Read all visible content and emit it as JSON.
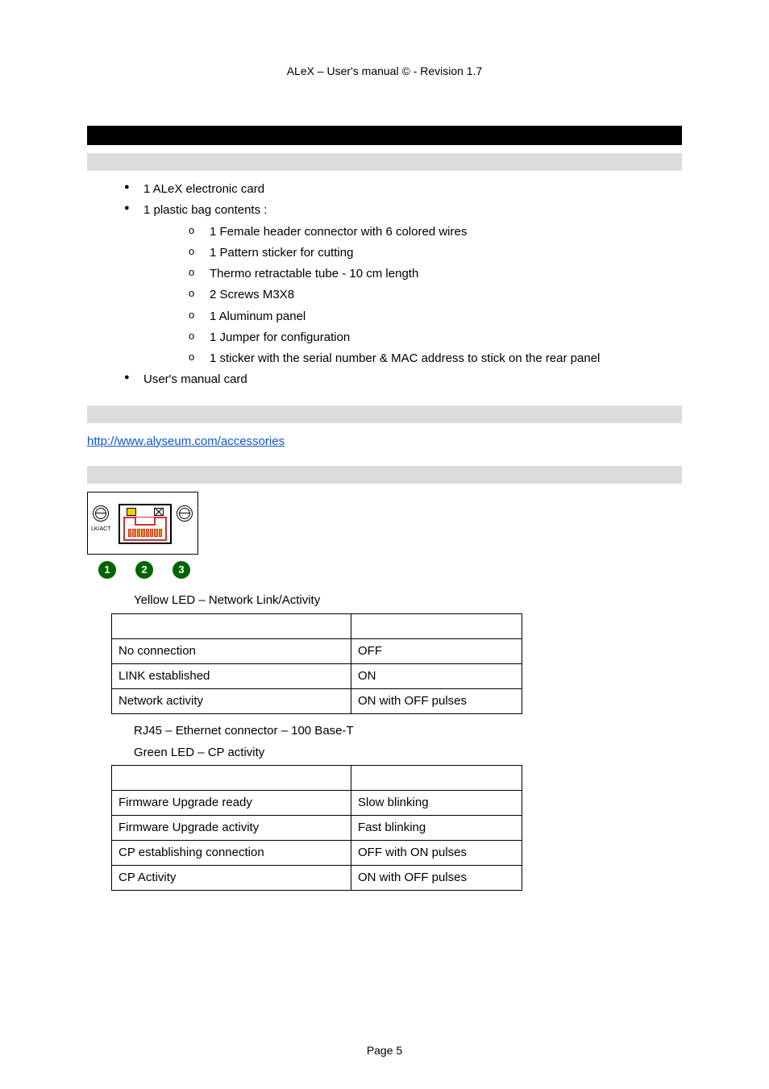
{
  "header": "ALeX – User's manual © -  Revision 1.7",
  "bullets": [
    "1 ALeX electronic card",
    "1 plastic bag contents :"
  ],
  "sub_bullets": [
    "1 Female header connector with 6 colored wires",
    "1 Pattern sticker for cutting",
    "Thermo retractable tube - 10 cm length",
    "2 Screws M3X8",
    "1 Aluminum panel",
    "1 Jumper for configuration",
    "1 sticker with the serial number & MAC address to stick on the rear panel"
  ],
  "bullets2": [
    "User's manual card"
  ],
  "accessories_url": "http://www.alyseum.com/accessories",
  "lkact_label": "LK/ACT",
  "callout_numbers": [
    "1",
    "2",
    "3"
  ],
  "caption1": "Yellow LED  – Network Link/Activity",
  "table1": {
    "rows": [
      [
        "No connection",
        "OFF"
      ],
      [
        "LINK established",
        "ON"
      ],
      [
        "Network activity",
        "ON with OFF pulses"
      ]
    ]
  },
  "caption2a": "RJ45 – Ethernet connector – 100 Base-T",
  "caption2b": "Green LED – CP activity",
  "table2": {
    "rows": [
      [
        "Firmware Upgrade ready",
        "Slow blinking"
      ],
      [
        "Firmware Upgrade activity",
        "Fast blinking"
      ],
      [
        "CP establishing connection",
        "OFF with ON pulses"
      ],
      [
        "CP Activity",
        "ON with OFF pulses"
      ]
    ]
  },
  "footer": "Page 5"
}
